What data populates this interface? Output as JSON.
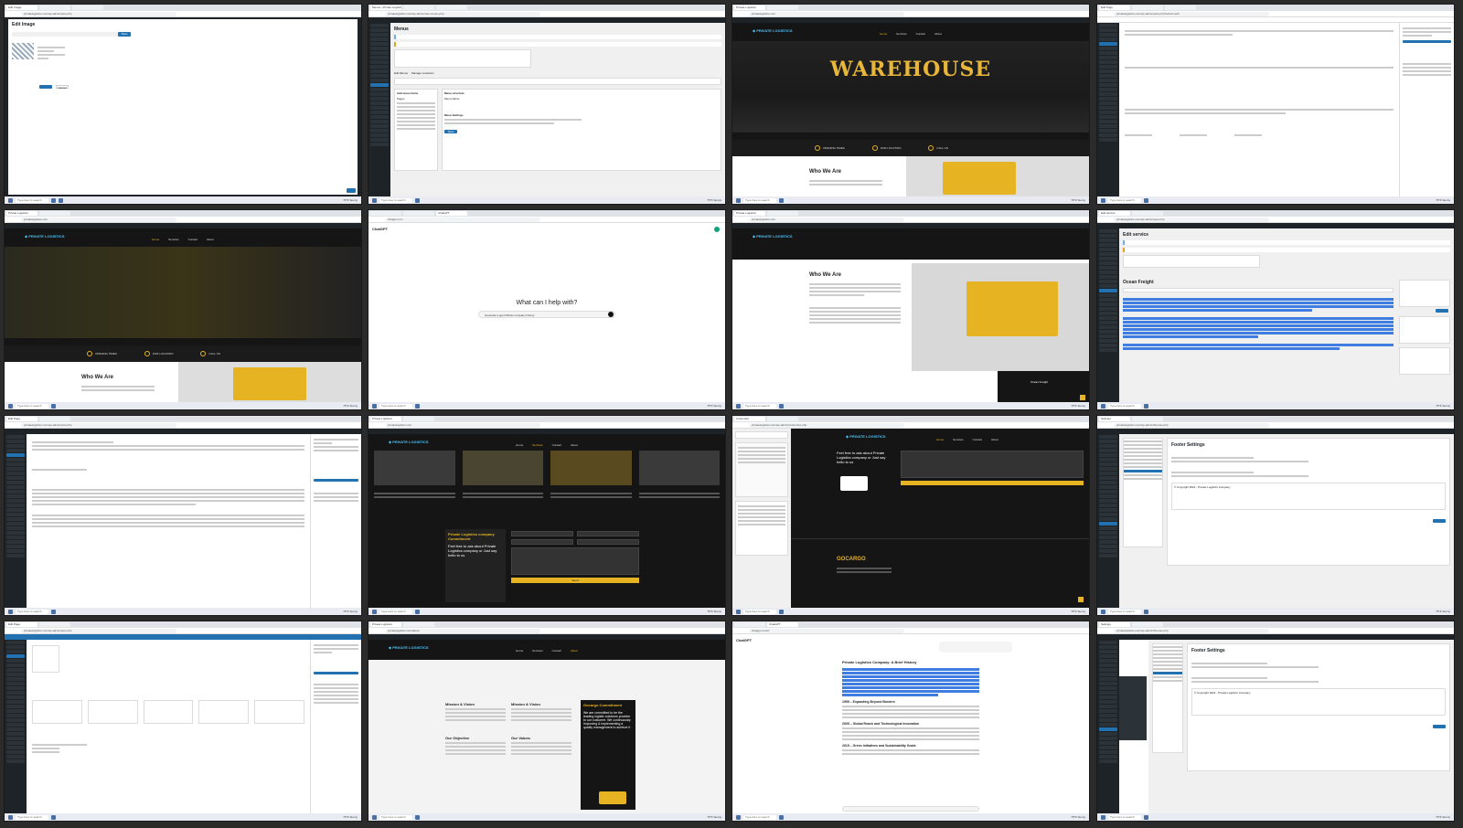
{
  "taskbar": {
    "search_placeholder": "Type here to search",
    "weather": "75°F Sunny"
  },
  "cells": {
    "c1": {
      "tab": "Edit Image",
      "url": "privatelogistics.com/wp-admin/post.php",
      "heading": "Edit Image",
      "save_label": "Save Edits",
      "cancel_label": "Cancel"
    },
    "c2": {
      "tab": "Menus ‹ Private Logistics",
      "url": "privatelogistics.com/wp-admin/nav-menus.php",
      "heading": "Menus",
      "tab_edit": "Edit Menus",
      "tab_manage": "Manage Locations",
      "add_items": "Add menu items",
      "structure": "Menu structure",
      "menu_name": "Menu Name",
      "settings": "Menu Settings",
      "pages": "Pages",
      "save": "Save Menu"
    },
    "c3": {
      "tab": "Private Logistics",
      "url": "privatelogistics.com",
      "hero": "WAREHOUSE",
      "nav": [
        "Home",
        "Services",
        "Contact",
        "About"
      ],
      "info": [
        "OPENING TIMES",
        "OUR LOCATION",
        "CALL US"
      ],
      "section": "Who We Are"
    },
    "c4": {
      "tab": "Edit Page",
      "url": "privatelogistics.com/wp-admin/post.php?action=edit"
    },
    "c5": {
      "tab": "Private Logistics",
      "url": "privatelogistics.com",
      "nav": [
        "Home",
        "Services",
        "Contact",
        "About"
      ],
      "info": [
        "OPENING TIMES",
        "OUR LOCATION",
        "CALL US"
      ],
      "section": "Who We Are"
    },
    "c6": {
      "tab": "ChatGPT",
      "url": "chatgpt.com",
      "app": "ChatGPT",
      "question": "What can I help with?",
      "prompt": "Generate a good Whois company history"
    },
    "c7": {
      "tab": "Private Logistics",
      "url": "privatelogistics.com",
      "section": "Who We Are",
      "badge": "Ocean Freight"
    },
    "c8": {
      "tab": "Edit service",
      "url": "privatelogistics.com/wp-admin/post.php",
      "heading": "Edit service",
      "title": "Ocean Freight"
    },
    "c9": {
      "tab": "Edit Page",
      "url": "privatelogistics.com/wp-admin/post.php"
    },
    "c10": {
      "tab": "Private Logistics",
      "url": "privatelogistics.com",
      "nav": [
        "Home",
        "Services",
        "Contact",
        "About"
      ],
      "cta_title": "Private Logistics company Commitment",
      "cta_text": "Feel free to ask about Private Logistics company or Just say hello to us",
      "send": "Send"
    },
    "c11": {
      "tab": "Customize",
      "url": "privatelogistics.com/wp-admin/customize.php",
      "nav": [
        "Home",
        "Services",
        "Contact",
        "About"
      ],
      "cta_text": "Feel free to ask about Private Logistics company or Just say hello to us",
      "brand": "GOCARGO"
    },
    "c12": {
      "tab": "Settings",
      "url": "privatelogistics.com/wp-admin/themes.php",
      "heading": "Footer Settings",
      "copyright": "© Copyright 2024 - Private Logistics Company"
    },
    "c13": {
      "tab": "Edit Page",
      "url": "privatelogistics.com/wp-admin/post.php"
    },
    "c14": {
      "tab": "Private Logistics",
      "url": "privatelogistics.com/about",
      "nav": [
        "Home",
        "Services",
        "Contact",
        "About"
      ],
      "mission": "Mission & Vision",
      "objective": "Our Objective",
      "values": "Our Values",
      "commit": "Gocargo Commitment",
      "commit_text": "We are committed to be the leading logistic solutions provider to our customer. We continuously improving & implementing a quality management to achieve it"
    },
    "c15": {
      "tab": "ChatGPT",
      "url": "chatgpt.com/c/",
      "app": "ChatGPT",
      "heading": "Private Logistics Company: A Brief History",
      "h2": "1995 – Expanding Beyond Borders",
      "h3": "2005 – Global Reach and Technological Innovation",
      "h4": "2015 – Green Initiatives and Sustainability Goals"
    },
    "c16": {
      "tab": "Settings",
      "url": "privatelogistics.com/wp-admin/themes.php",
      "heading": "Footer Settings",
      "copyright": "© Copyright 2024 - Private Logistics Company"
    }
  },
  "colors": {
    "accent": "#e6b422",
    "wp_blue": "#2271b1",
    "wp_dark": "#1d2327",
    "selection": "#3f7ee0"
  }
}
